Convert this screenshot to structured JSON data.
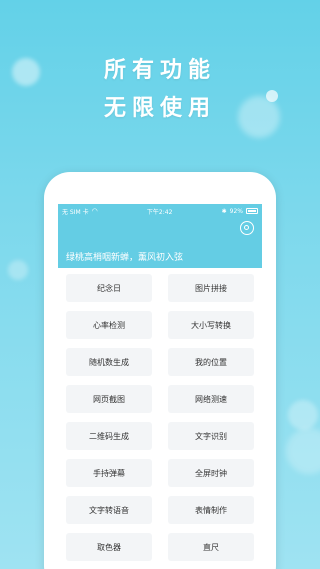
{
  "headline": {
    "line1": "所有功能",
    "line2": "无限使用"
  },
  "status_bar": {
    "carrier": "无 SIM 卡",
    "time": "下午2:42",
    "battery": "92%"
  },
  "header": {
    "slogan": "绿桃高梢咽新蝉，薰风初入弦"
  },
  "features": [
    "纪念日",
    "图片拼接",
    "心率检测",
    "大小写转换",
    "随机数生成",
    "我的位置",
    "网页截图",
    "网络测速",
    "二维码生成",
    "文字识别",
    "手持弹幕",
    "全屏时钟",
    "文字转语音",
    "表情制作",
    "取色器",
    "直尺"
  ],
  "colors": {
    "background": "#63d1e8",
    "header": "#64cde4",
    "cell": "#f3f5f7"
  }
}
